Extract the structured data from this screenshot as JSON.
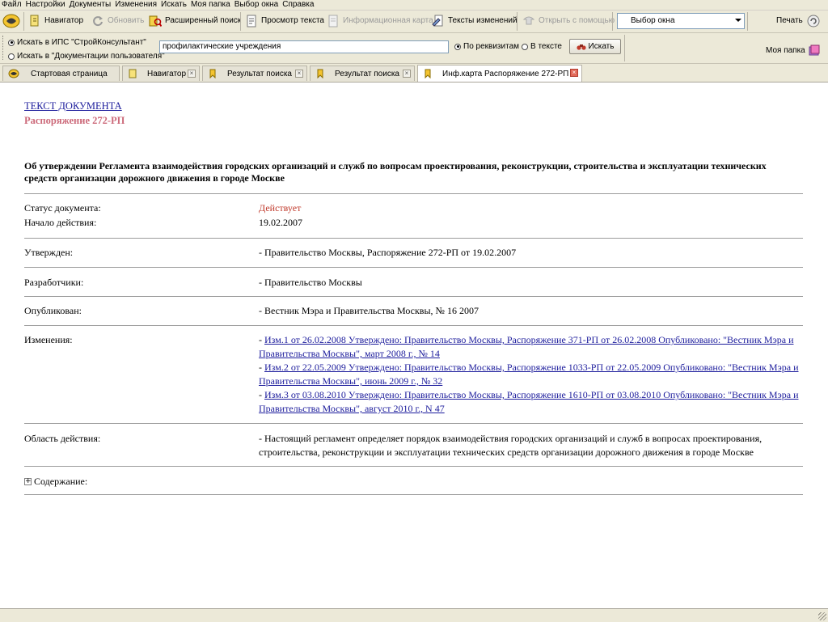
{
  "menu": [
    "Файл",
    "Настройки",
    "Документы",
    "Изменения",
    "Искать",
    "Моя папка",
    "Выбор окна",
    "Справка"
  ],
  "toolbar": {
    "navigator": "Навигатор",
    "refresh": "Обновить",
    "advanced_search": "Расширенный поиск",
    "view_text": "Просмотр текста",
    "info_card": "Информационная карта",
    "change_texts": "Тексты изменений",
    "open_with": "Открыть с помощью",
    "window_select": "Выбор окна",
    "print": "Печать"
  },
  "search": {
    "scope_option_1": "Искать в ИПС \"СтройКонсультант\"",
    "scope_option_2": "Искать в \"Документации пользователя\"",
    "query": "профилактические учреждения",
    "mode_option_1": "По реквизитам",
    "mode_option_2": "В тексте",
    "button": "Искать",
    "my_folder": "Моя папка"
  },
  "tabs": [
    {
      "label": "Стартовая страница"
    },
    {
      "label": "Навигатор"
    },
    {
      "label": "Результат поиска"
    },
    {
      "label": "Результат поиска"
    },
    {
      "label": "Инф.карта Распоряжение 272-РП ..."
    }
  ],
  "document": {
    "text_link": "ТЕКСТ ДОКУМЕНТА",
    "number": "Распоряжение 272-РП",
    "title": "Об утверждении Регламента взаимодействия городских организаций и служб по вопросам проектирования, реконструкции, строительства и эксплуатации технических средств организации дорожного движения в городе Москве",
    "status_label": "Статус документа:",
    "status_value": "Действует",
    "start_label": "Начало действия:",
    "start_value": "19.02.2007",
    "approved_label": "Утвержден:",
    "approved_value": "- Правительство Москвы, Распоряжение 272-РП от 19.02.2007",
    "developers_label": "Разработчики:",
    "developers_value": "- Правительство Москвы",
    "published_label": "Опубликован:",
    "published_value": "- Вестник Мэра и Правительства Москвы, № 16 2007",
    "changes_label": "Изменения:",
    "changes": [
      "Изм.1 от 26.02.2008 Утверждено: Правительство Москвы, Распоряжение 371-РП от 26.02.2008 Опубликовано: \"Вестник Мэра и Правительства Москвы\", март 2008 г., № 14",
      "Изм.2 от 22.05.2009 Утверждено: Правительство Москвы, Распоряжение 1033-РП от 22.05.2009 Опубликовано: \"Вестник Мэра и Правительства Москвы\", июнь 2009 г., № 32",
      "Изм.3 от 03.08.2010 Утверждено: Правительство Москвы, Распоряжение 1610-РП от 03.08.2010 Опубликовано: \"Вестник Мэра и Правительства Москвы\", август 2010 г., N 47"
    ],
    "change_prefix": "- ",
    "scope_label": "Область действия:",
    "scope_value": "- Настоящий регламент определяет порядок взаимодействия городских организаций и служб в вопросах проектирования, строительства, реконструкции и эксплуатации технических средств организации дорожного движения в городе Москве",
    "contents_label": "Содержание:"
  }
}
